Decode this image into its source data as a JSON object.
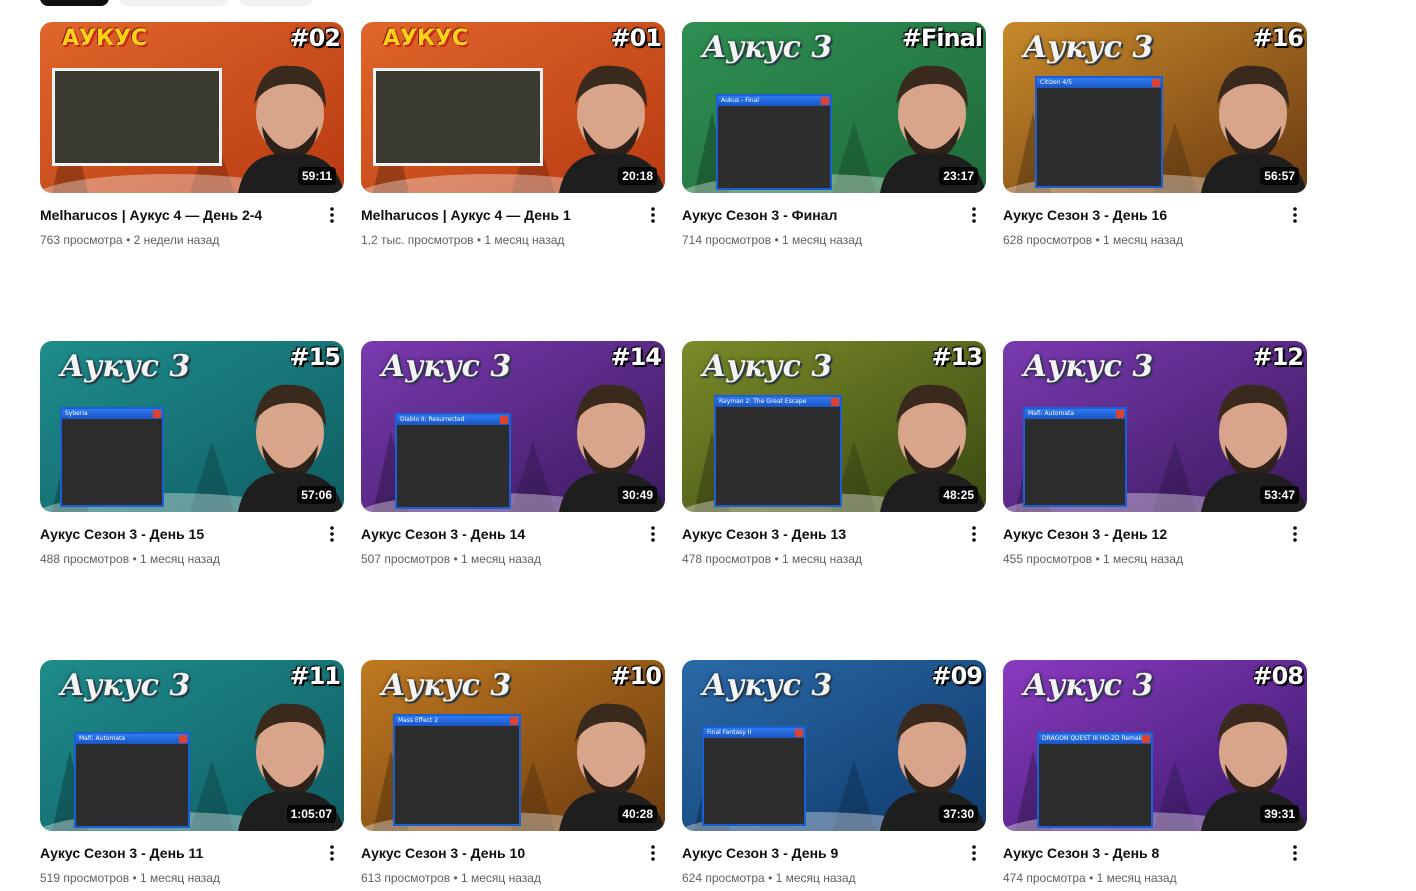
{
  "videos": [
    {
      "title": "Melharucos | Аукус 4 — День 2-4",
      "views": "763 просмотра",
      "age": "2 недели назад",
      "duration": "59:11",
      "episode": "#02",
      "brand": "АУКУС",
      "style": "orange",
      "window_title": ""
    },
    {
      "title": "Melharucos | Аукус 4 — День 1",
      "views": "1,2 тыс. просмотров",
      "age": "1 месяц назад",
      "duration": "20:18",
      "episode": "#01",
      "brand": "АУКУС",
      "style": "orange",
      "window_title": ""
    },
    {
      "title": "Аукус Сезон 3 - Финал",
      "views": "714 просмотров",
      "age": "1 месяц назад",
      "duration": "23:17",
      "episode": "#Final",
      "brand": "Аукус 3",
      "style": "green",
      "window_title": "Aukus - Final"
    },
    {
      "title": "Аукус Сезон 3 - День 16",
      "views": "628 просмотров",
      "age": "1 месяц назад",
      "duration": "56:57",
      "episode": "#16",
      "brand": "Аукус 3",
      "style": "gold",
      "window_title": "Citizen 4/5"
    },
    {
      "title": "Аукус Сезон 3 - День 15",
      "views": "488 просмотров",
      "age": "1 месяц назад",
      "duration": "57:06",
      "episode": "#15",
      "brand": "Аукус 3",
      "style": "teal",
      "window_title": "Syberia"
    },
    {
      "title": "Аукус Сезон 3 - День 14",
      "views": "507 просмотров",
      "age": "1 месяц назад",
      "duration": "30:49",
      "episode": "#14",
      "brand": "Аукус 3",
      "style": "purple",
      "window_title": "Diablo II: Resurrected"
    },
    {
      "title": "Аукус Сезон 3 - День 13",
      "views": "478 просмотров",
      "age": "1 месяц назад",
      "duration": "48:25",
      "episode": "#13",
      "brand": "Аукус 3",
      "style": "olive",
      "window_title": "Rayman 2: The Great Escape"
    },
    {
      "title": "Аукус Сезон 3 - День 12",
      "views": "455 просмотров",
      "age": "1 месяц назад",
      "duration": "53:47",
      "episode": "#12",
      "brand": "Аукус 3",
      "style": "purple",
      "window_title": "Mafi: Automata"
    },
    {
      "title": "Аукус Сезон 3 - День 11",
      "views": "519 просмотров",
      "age": "1 месяц назад",
      "duration": "1:05:07",
      "episode": "#11",
      "brand": "Аукус 3",
      "style": "teal",
      "window_title": "Mafi: Automata"
    },
    {
      "title": "Аукус Сезон 3 - День 10",
      "views": "613 просмотров",
      "age": "1 месяц назад",
      "duration": "40:28",
      "episode": "#10",
      "brand": "Аукус 3",
      "style": "amber",
      "window_title": "Mass Effect 2"
    },
    {
      "title": "Аукус Сезон 3 - День 9",
      "views": "624 просмотра",
      "age": "1 месяц назад",
      "duration": "37:30",
      "episode": "#09",
      "brand": "Аукус 3",
      "style": "blue",
      "window_title": "Final Fantasy II"
    },
    {
      "title": "Аукус Сезон 3 - День 8",
      "views": "474 просмотра",
      "age": "1 месяц назад",
      "duration": "39:31",
      "episode": "#08",
      "brand": "Аукус 3",
      "style": "violet",
      "window_title": "DRAGON QUEST III HD-2D Remake"
    }
  ],
  "separator": "•",
  "icons": {
    "more": "more-vert-icon"
  },
  "palettes": {
    "orange": [
      "#b83a12",
      "#e0662a"
    ],
    "green": [
      "#1f6b3a",
      "#2f8f52"
    ],
    "gold": [
      "#6b3a12",
      "#c88a2a"
    ],
    "teal": [
      "#0f5e63",
      "#1f8c8c"
    ],
    "purple": [
      "#3b1a5e",
      "#7a3ab0"
    ],
    "olive": [
      "#3a4a12",
      "#7a8a2a"
    ],
    "amber": [
      "#6a3a10",
      "#c07a20"
    ],
    "blue": [
      "#0f3a6b",
      "#2a6aa8"
    ],
    "violet": [
      "#3a1a6b",
      "#8a3ac0"
    ]
  }
}
